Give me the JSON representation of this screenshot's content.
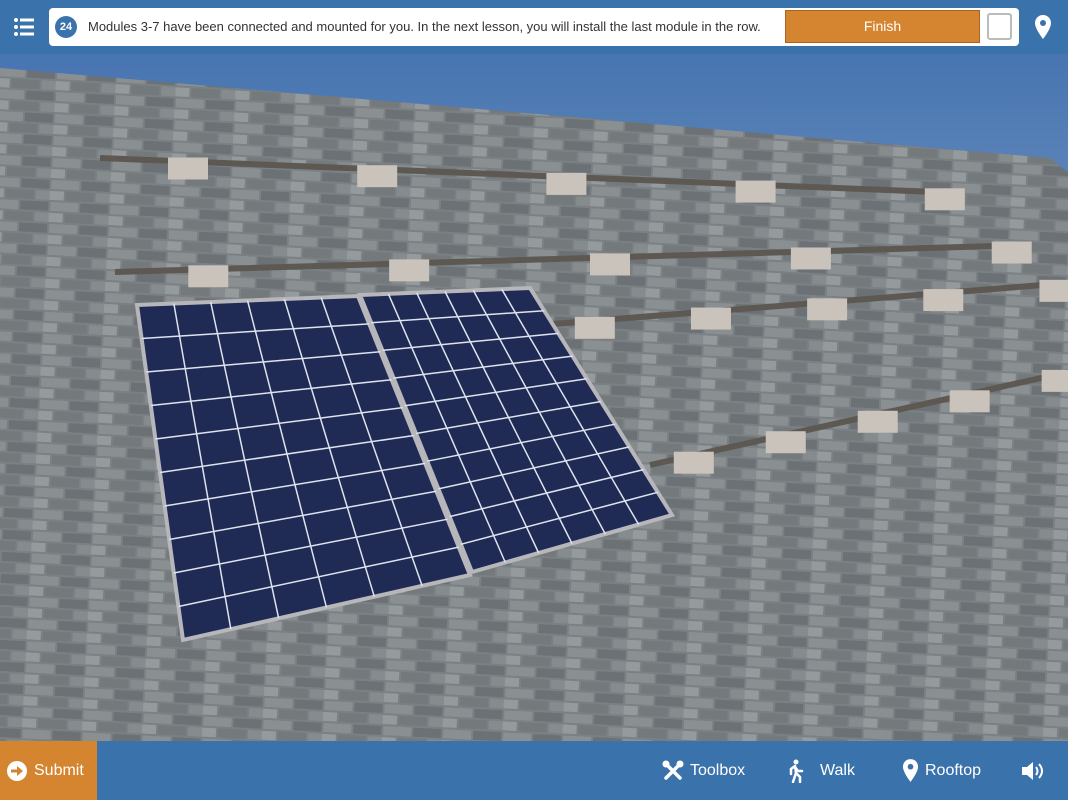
{
  "header": {
    "step_number": "24",
    "instruction": "Modules 3-7 have been connected and mounted for you. In the next lesson, you will install the last module in the row.",
    "finish_label": "Finish"
  },
  "footer": {
    "submit_label": "Submit",
    "toolbox_label": "Toolbox",
    "walk_label": "Walk",
    "rooftop_label": "Rooftop"
  },
  "colors": {
    "brand": "#3a72ab",
    "accent": "#d5842f"
  }
}
